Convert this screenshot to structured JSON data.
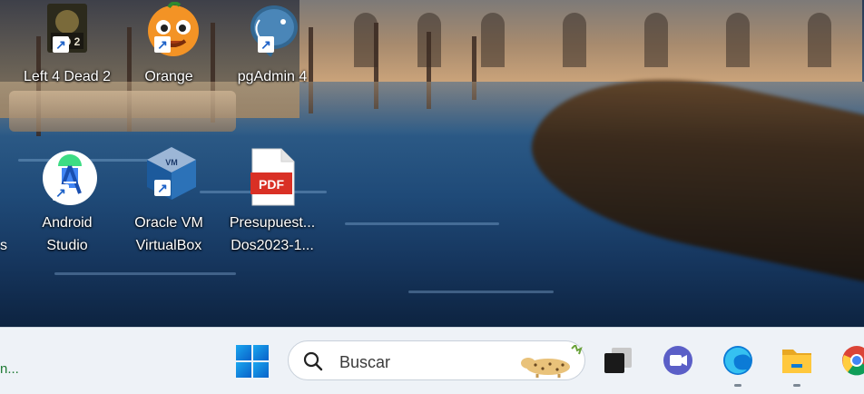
{
  "desktop": {
    "icons": [
      {
        "label": "Left 4 Dead 2",
        "icon": "left4dead2-icon",
        "shortcut": true
      },
      {
        "label": "Orange",
        "icon": "orange-icon",
        "shortcut": true
      },
      {
        "label": "pgAdmin 4",
        "icon": "pgadmin-elephant-icon",
        "shortcut": true
      },
      {
        "label": "Android Studio",
        "icon": "android-studio-icon",
        "shortcut": true
      },
      {
        "label": "Oracle VM VirtualBox",
        "icon": "virtualbox-icon",
        "shortcut": true
      },
      {
        "label": "Presupuest... Dos2023-1...",
        "icon": "pdf-file-icon",
        "shortcut": false
      }
    ],
    "cut_label": "s",
    "pdf_badge": "PDF"
  },
  "taskbar": {
    "widget_text": "n...",
    "search": {
      "placeholder": "Buscar",
      "value": ""
    },
    "apps": [
      "task-view-icon",
      "teams-chat-icon",
      "edge-icon",
      "file-explorer-icon",
      "chrome-icon"
    ]
  },
  "colors": {
    "taskbar_bg": "#eef2f7",
    "windows_blue": "#1aa7ef",
    "pdf_red": "#d93025",
    "teams_purple": "#5b5fc7"
  }
}
